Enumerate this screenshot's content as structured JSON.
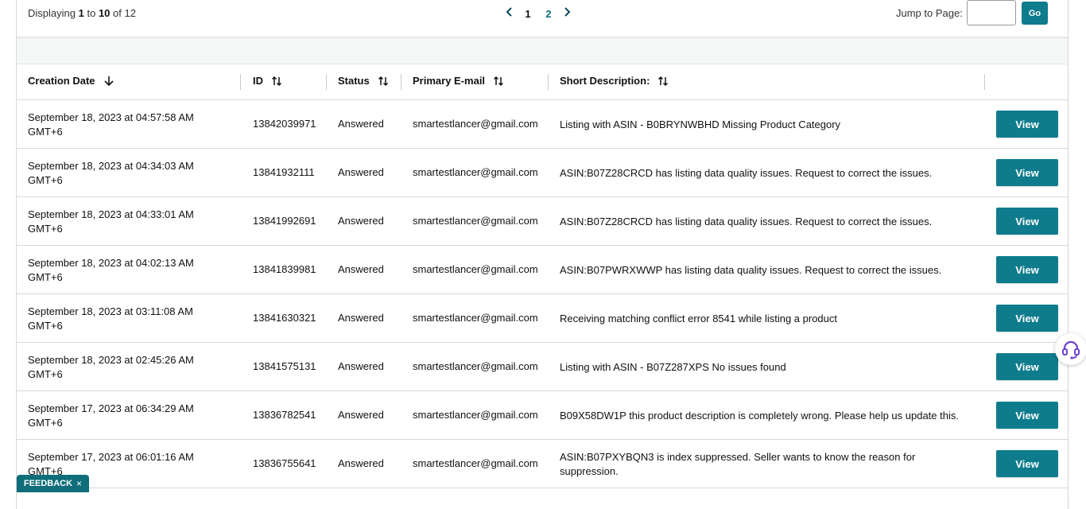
{
  "pagination": {
    "displaying_prefix": "Displaying",
    "from": "1",
    "to_word": "to",
    "to": "10",
    "of_word": "of",
    "total": "12",
    "pages": [
      "1",
      "2"
    ],
    "current_page": "1",
    "jump_label": "Jump to Page:",
    "jump_value": "",
    "go_label": "Go"
  },
  "columns": {
    "creation_date": "Creation Date",
    "id": "ID",
    "status": "Status",
    "email": "Primary E-mail",
    "description": "Short Description:"
  },
  "rows": [
    {
      "date": "September 18, 2023 at 04:57:58 AM",
      "tz": "GMT+6",
      "id": "13842039971",
      "status": "Answered",
      "email": "smartestlancer@gmail.com",
      "desc": "Listing with ASIN - B0BRYNWBHD Missing Product Category",
      "view": "View"
    },
    {
      "date": "September 18, 2023 at 04:34:03 AM",
      "tz": "GMT+6",
      "id": "13841932111",
      "status": "Answered",
      "email": "smartestlancer@gmail.com",
      "desc": "ASIN:B07Z28CRCD has listing data quality issues. Request to correct the issues.",
      "view": "View"
    },
    {
      "date": "September 18, 2023 at 04:33:01 AM",
      "tz": "GMT+6",
      "id": "13841992691",
      "status": "Answered",
      "email": "smartestlancer@gmail.com",
      "desc": "ASIN:B07Z28CRCD has listing data quality issues. Request to correct the issues.",
      "view": "View"
    },
    {
      "date": "September 18, 2023 at 04:02:13 AM",
      "tz": "GMT+6",
      "id": "13841839981",
      "status": "Answered",
      "email": "smartestlancer@gmail.com",
      "desc": "ASIN:B07PWRXWWP has listing data quality issues. Request to correct the issues.",
      "view": "View"
    },
    {
      "date": "September 18, 2023 at 03:11:08 AM",
      "tz": "GMT+6",
      "id": "13841630321",
      "status": "Answered",
      "email": "smartestlancer@gmail.com",
      "desc": "Receiving matching conflict error 8541 while listing a product",
      "view": "View"
    },
    {
      "date": "September 18, 2023 at 02:45:26 AM",
      "tz": "GMT+6",
      "id": "13841575131",
      "status": "Answered",
      "email": "smartestlancer@gmail.com",
      "desc": "Listing with ASIN - B07Z287XPS No issues found",
      "view": "View"
    },
    {
      "date": "September 17, 2023 at 06:34:29 AM",
      "tz": "GMT+6",
      "id": "13836782541",
      "status": "Answered",
      "email": "smartestlancer@gmail.com",
      "desc": "B09X58DW1P this product description is completely wrong. Please help us update this.",
      "view": "View"
    },
    {
      "date": "September 17, 2023 at 06:01:16 AM",
      "tz": "GMT+6",
      "id": "13836755641",
      "status": "Answered",
      "email": "smartestlancer@gmail.com",
      "desc": "ASIN:B07PXYBQN3 is index suppressed. Seller wants to know the reason for suppression.",
      "view": "View"
    }
  ],
  "feedback": {
    "label": "FEEDBACK",
    "close": "×"
  },
  "icons": {
    "prev": "chevron-left-icon",
    "next": "chevron-right-icon",
    "sort_desc": "arrow-down-icon",
    "sort_both": "sort-updown-icon",
    "support": "headset-icon"
  },
  "colors": {
    "accent": "#0f7c8d",
    "support_icon": "#6b3fd1"
  }
}
